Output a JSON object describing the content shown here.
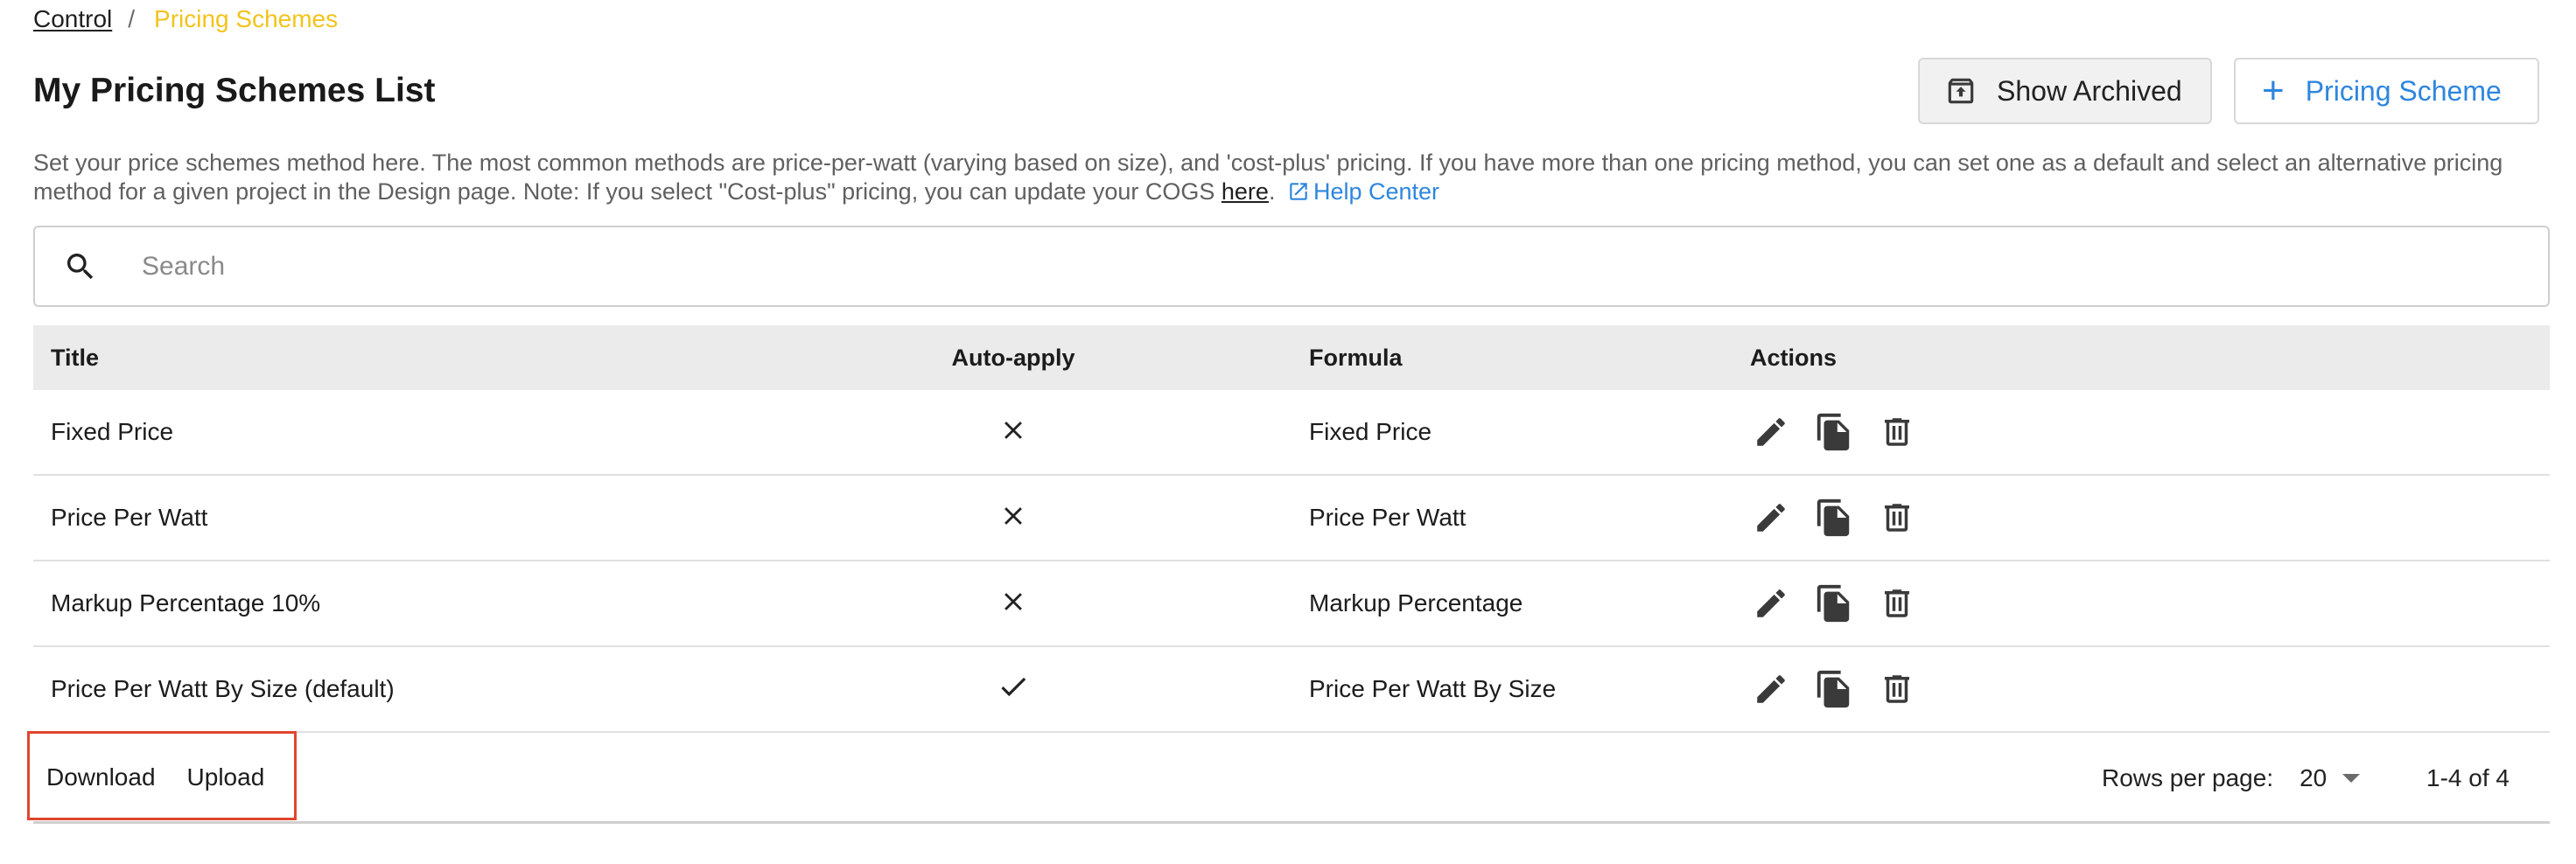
{
  "breadcrumb": {
    "root": "Control",
    "separator": "/",
    "current": "Pricing Schemes"
  },
  "page": {
    "title": "My Pricing Schemes List"
  },
  "toolbar": {
    "show_archived_label": "Show Archived",
    "add_scheme_label": "Pricing Scheme"
  },
  "description": {
    "text": "Set your price schemes method here. The most common methods are price-per-watt (varying based on size), and 'cost-plus' pricing. If you have more than one pricing method, you can set one as a default and select an alternative pricing method for a given project in the Design page. Note: If you select \"Cost-plus\" pricing, you can update your COGS ",
    "link_label": "here",
    "after_link": ".",
    "help_label": "Help Center"
  },
  "search": {
    "placeholder": "Search",
    "value": ""
  },
  "table": {
    "headers": {
      "title": "Title",
      "auto_apply": "Auto-apply",
      "formula": "Formula",
      "actions": "Actions"
    },
    "rows": [
      {
        "title": "Fixed Price",
        "auto_apply": "no",
        "formula": "Fixed Price"
      },
      {
        "title": "Price Per Watt",
        "auto_apply": "no",
        "formula": "Price Per Watt"
      },
      {
        "title": "Markup Percentage 10%",
        "auto_apply": "no",
        "formula": "Markup Percentage"
      },
      {
        "title": "Price Per Watt By Size (default)",
        "auto_apply": "yes",
        "formula": "Price Per Watt By Size"
      }
    ],
    "row_icons": [
      "pencil-icon",
      "copy-icon",
      "trash-icon"
    ]
  },
  "footer": {
    "download_label": "Download",
    "upload_label": "Upload",
    "rows_per_page_label": "Rows per page:",
    "rows_per_page_value": "20",
    "range_label": "1-4 of 4"
  },
  "colors": {
    "accent": "#2e86de",
    "breadcrumb_current": "#f2c31b",
    "highlight": "#e0452f",
    "header_bg": "#ebebeb"
  }
}
